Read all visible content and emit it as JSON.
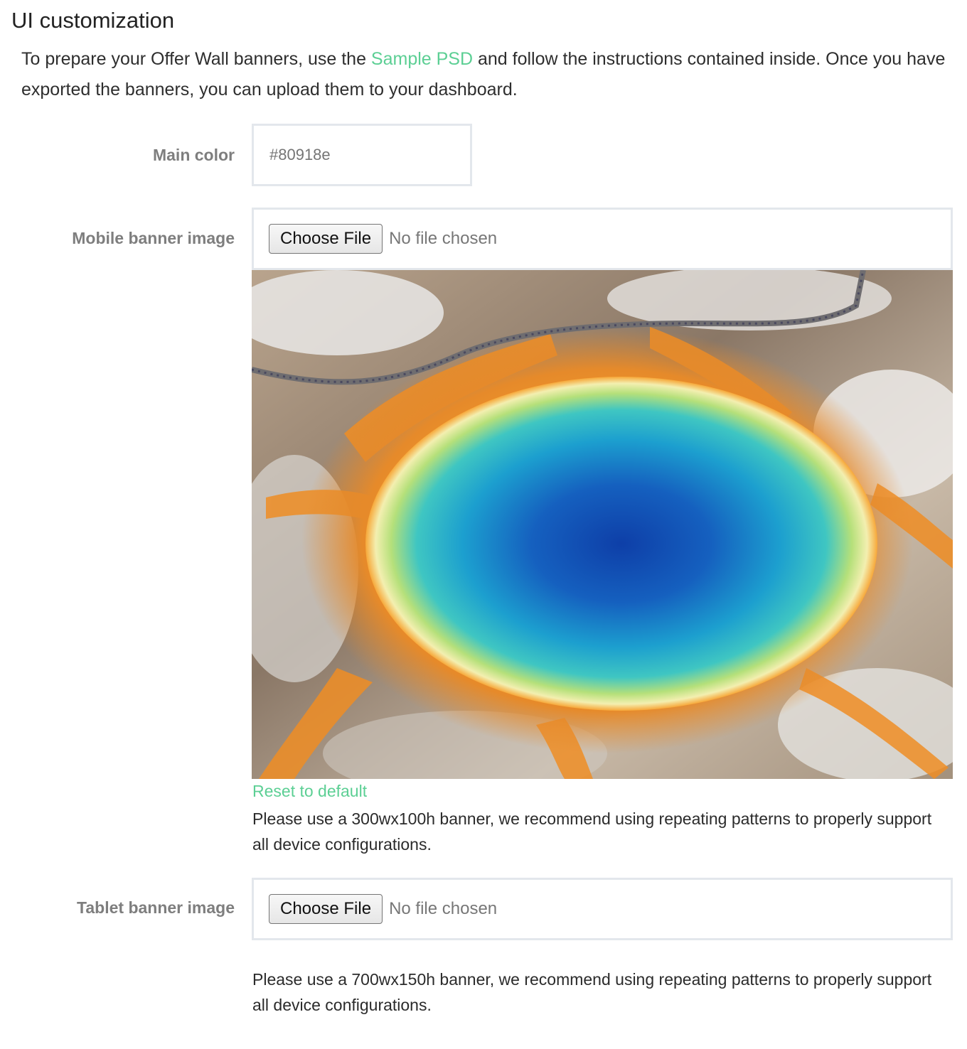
{
  "section": {
    "title": "UI customization"
  },
  "intro": {
    "text_before_link": "To prepare your Offer Wall banners, use the ",
    "link_label": "Sample PSD",
    "text_after_link": " and follow the instructions contained inside. Once you have exported the banners, you can upload them to your dashboard."
  },
  "main_color": {
    "label": "Main color",
    "placeholder": "#80918e"
  },
  "mobile_banner": {
    "label": "Mobile banner image",
    "choose_file_label": "Choose File",
    "no_file_text": "No file chosen",
    "reset_label": "Reset to default",
    "help_text": "Please use a 300wx100h banner, we recommend using repeating patterns to properly support all device configurations."
  },
  "tablet_banner": {
    "label": "Tablet banner image",
    "choose_file_label": "Choose File",
    "no_file_text": "No file chosen",
    "help_text": "Please use a 700wx150h banner, we recommend using repeating patterns to properly support all device configurations."
  },
  "colors": {
    "accent_link": "#5ccf94",
    "label_gray": "#7e7e7e",
    "input_border": "#e3e7ec"
  }
}
